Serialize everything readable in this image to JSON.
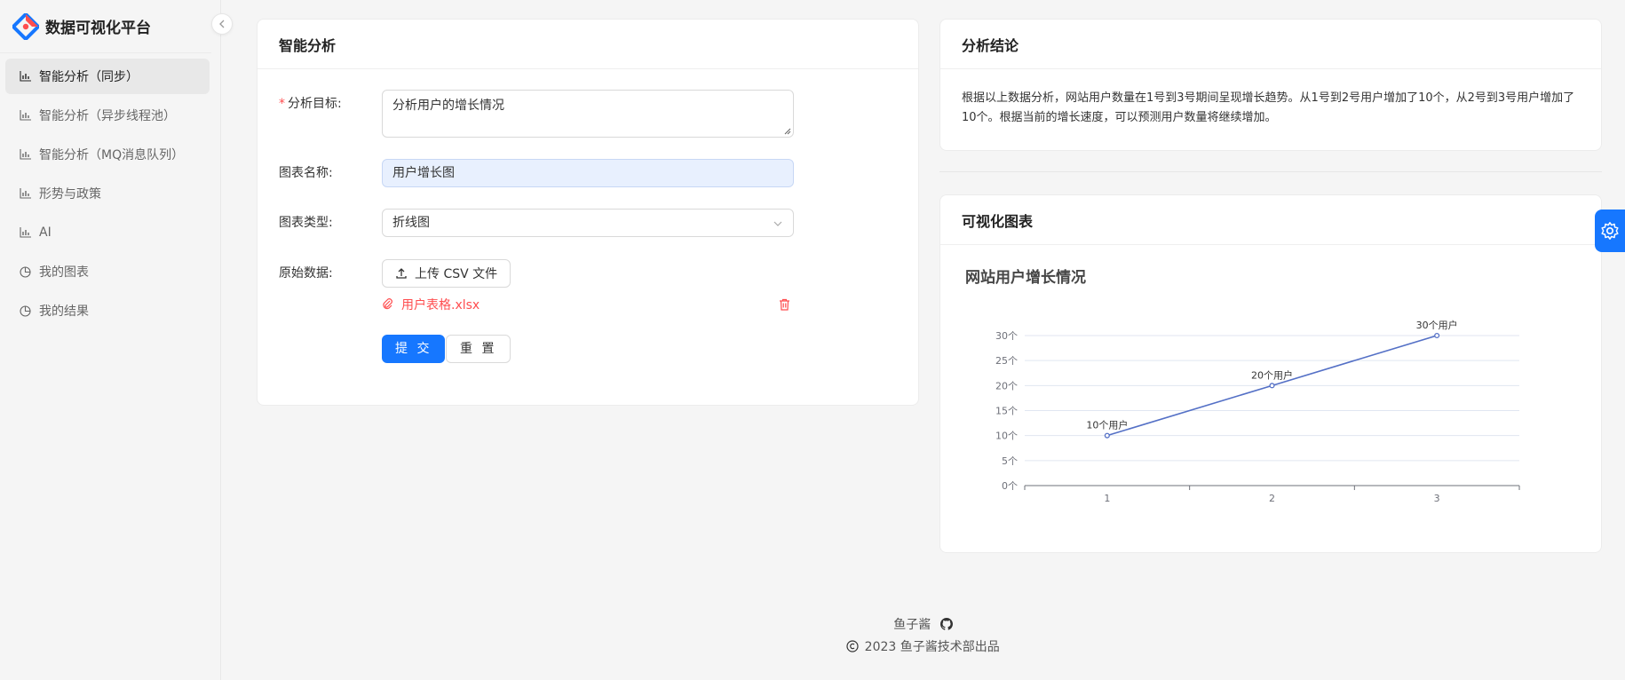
{
  "app": {
    "title": "数据可视化平台"
  },
  "sidebar": {
    "items": [
      {
        "label": "智能分析（同步）",
        "icon": "bar-chart-icon",
        "active": true
      },
      {
        "label": "智能分析（异步线程池）",
        "icon": "bar-chart-icon",
        "active": false
      },
      {
        "label": "智能分析（MQ消息队列）",
        "icon": "bar-chart-icon",
        "active": false
      },
      {
        "label": "形势与政策",
        "icon": "bar-chart-icon",
        "active": false
      },
      {
        "label": "AI",
        "icon": "bar-chart-icon",
        "active": false
      },
      {
        "label": "我的图表",
        "icon": "pie-chart-icon",
        "active": false
      },
      {
        "label": "我的结果",
        "icon": "pie-chart-icon",
        "active": false
      }
    ]
  },
  "analysis": {
    "title": "智能分析",
    "goal_label": "分析目标:",
    "goal_value": "分析用户的增长情况",
    "name_label": "图表名称:",
    "name_value": "用户增长图",
    "type_label": "图表类型:",
    "type_value": "折线图",
    "data_label": "原始数据:",
    "upload_label": "上传 CSV 文件",
    "file_name": "用户表格.xlsx",
    "submit_label": "提 交",
    "reset_label": "重 置"
  },
  "conclusion": {
    "title": "分析结论",
    "text": "根据以上数据分析，网站用户数量在1号到3号期间呈现增长趋势。从1号到2号用户增加了10个，从2号到3号用户增加了10个。根据当前的增长速度，可以预测用户数量将继续增加。"
  },
  "visual": {
    "title": "可视化图表"
  },
  "chart_data": {
    "type": "line",
    "title": "网站用户增长情况",
    "categories": [
      "1",
      "2",
      "3"
    ],
    "series": [
      {
        "values": [
          10,
          20,
          30
        ],
        "labels": [
          "10个用户",
          "20个用户",
          "30个用户"
        ]
      }
    ],
    "y_ticks": [
      "0个",
      "5个",
      "10个",
      "15个",
      "20个",
      "25个",
      "30个"
    ],
    "ylim": [
      0,
      30
    ],
    "grid": true,
    "color": "#5470c6"
  },
  "footer": {
    "author": "鱼子酱",
    "copyright": "2023 鱼子酱技术部出品"
  },
  "colors": {
    "primary": "#1677ff",
    "danger": "#ff4d4f",
    "series": "#5470c6"
  }
}
